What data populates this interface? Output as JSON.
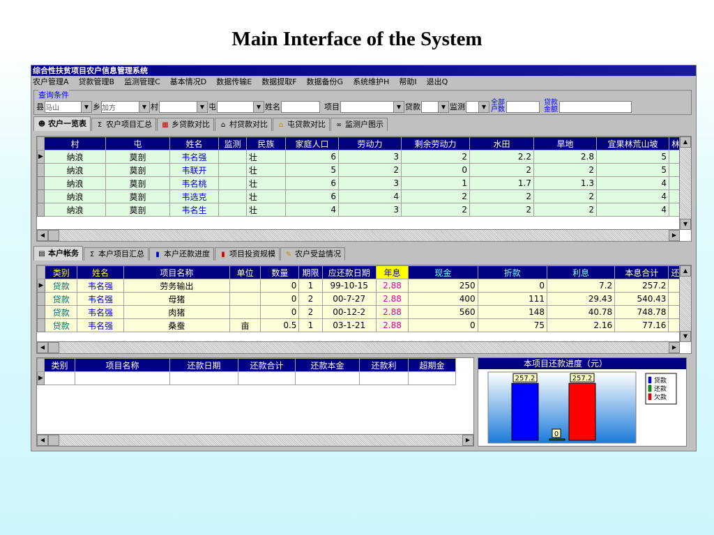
{
  "slide_title": "Main Interface of the System",
  "window_title": "综合性扶贫项目农户信息管理系统",
  "menu": [
    "农户管理A",
    "贷款管理B",
    "监测管理C",
    "基本情况D",
    "数据传输E",
    "数据提取F",
    "数据备份G",
    "系统维护H",
    "帮助I",
    "退出Q"
  ],
  "query": {
    "legend": "查询条件",
    "county_label": "县",
    "county_value": "马山",
    "township_label": "乡",
    "township_value": "加方",
    "village_label": "村",
    "tun_label": "屯",
    "name_label": "姓名",
    "project_label": "项目",
    "loan_label": "贷款",
    "monitor_label": "监测",
    "all_households_label_1": "全部",
    "all_households_label_2": "户数",
    "loan_amount_label_1": "贷款",
    "loan_amount_label_2": "金额"
  },
  "top_tabs": [
    "农户一览表",
    "农户项目汇总",
    "乡贷款对比",
    "村贷款对比",
    "屯贷款对比",
    "监测户图示"
  ],
  "household_table": {
    "headers": [
      "村",
      "屯",
      "姓名",
      "监测",
      "民族",
      "家庭人口",
      "劳动力",
      "剩余劳动力",
      "水田",
      "旱地",
      "宜果林荒山坡",
      "林才"
    ],
    "rows": [
      [
        "纳浪",
        "莫剖",
        "韦名强",
        "",
        "壮",
        "6",
        "3",
        "2",
        "2.2",
        "2.8",
        "5"
      ],
      [
        "纳浪",
        "莫剖",
        "韦联开",
        "",
        "壮",
        "5",
        "2",
        "0",
        "2",
        "2",
        "5"
      ],
      [
        "纳浪",
        "莫剖",
        "韦名桃",
        "",
        "壮",
        "6",
        "3",
        "1",
        "1.7",
        "1.3",
        "4"
      ],
      [
        "纳浪",
        "莫剖",
        "韦选克",
        "",
        "壮",
        "6",
        "4",
        "2",
        "2",
        "2",
        "4"
      ],
      [
        "纳浪",
        "莫剖",
        "韦名生",
        "",
        "壮",
        "4",
        "3",
        "2",
        "2",
        "2",
        "4"
      ]
    ]
  },
  "mid_tabs": [
    "本户帐务",
    "本户项目汇总",
    "本户还款进度",
    "项目投资规模",
    "农户受益情况"
  ],
  "account_table": {
    "headers": [
      "类别",
      "姓名",
      "项目名称",
      "单位",
      "数量",
      "期限",
      "应还款日期",
      "年息",
      "现金",
      "折款",
      "利息",
      "本息合计",
      "还"
    ],
    "rows": [
      [
        "贷款",
        "韦名强",
        "劳务输出",
        "",
        "0",
        "1",
        "99-10-15",
        "2.88",
        "250",
        "0",
        "7.2",
        "257.2"
      ],
      [
        "贷款",
        "韦名强",
        "母猪",
        "",
        "0",
        "2",
        "00-7-27",
        "2.88",
        "400",
        "111",
        "29.43",
        "540.43"
      ],
      [
        "贷款",
        "韦名强",
        "肉猪",
        "",
        "0",
        "2",
        "00-12-2",
        "2.88",
        "560",
        "148",
        "40.78",
        "748.78"
      ],
      [
        "贷款",
        "韦名强",
        "桑蚕",
        "亩",
        "0.5",
        "1",
        "03-1-21",
        "2.88",
        "0",
        "75",
        "2.16",
        "77.16"
      ]
    ]
  },
  "repay_table": {
    "headers": [
      "类别",
      "项目名称",
      "还款日期",
      "还款合计",
      "还款本金",
      "还款利",
      "超期金"
    ]
  },
  "chart_data": {
    "type": "bar",
    "title": "本项目还款进度（元）",
    "categories": [
      "贷款",
      "还款",
      "欠款"
    ],
    "values": [
      257.2,
      0,
      257.2
    ],
    "data_labels": [
      "257.2",
      "0",
      "257.2"
    ],
    "legend": [
      "贷款",
      "还款",
      "欠款"
    ],
    "legend_position": "top-right",
    "colors": [
      "#0000ff",
      "#00a000",
      "#ff0000"
    ],
    "ylim": [
      0,
      300
    ]
  },
  "colors": {
    "titlebar": "#000080",
    "header_bg": "#000080",
    "row_green": "#e0fae0",
    "row_yellow": "#fdfdd8",
    "rate_pink": "#e000a0"
  }
}
